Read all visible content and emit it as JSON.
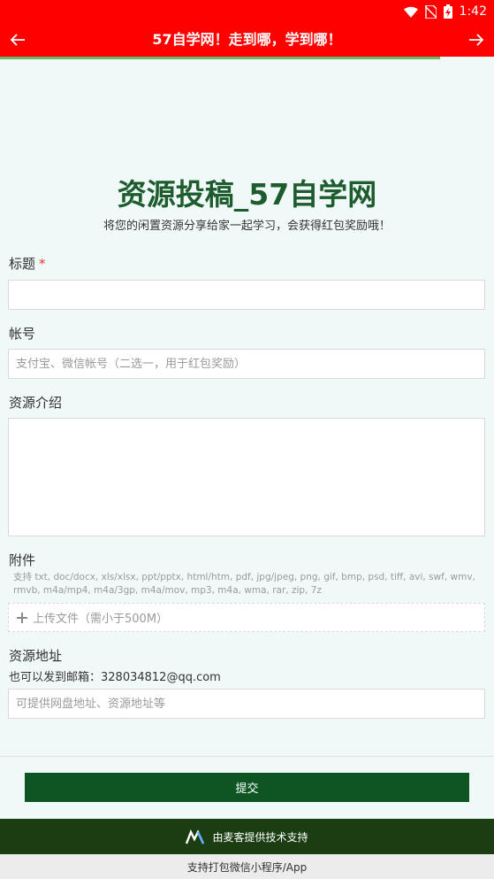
{
  "status_bar": {
    "time": "1:42"
  },
  "app_bar": {
    "title": "57自学网！走到哪，学到哪！"
  },
  "page_load_progress": 0.89,
  "header": {
    "title": "资源投稿_57自学网",
    "subtitle": "将您的闲置资源分享给家一起学习，会获得红包奖励哦！"
  },
  "form": {
    "title_label": "标题",
    "required_mark": "*",
    "title_value": "",
    "account_label": "帐号",
    "account_placeholder": "支付宝、微信帐号（二选一，用于红包奖励）",
    "intro_label": "资源介绍",
    "intro_value": "",
    "attachment_label": "附件",
    "attachment_hint": "支持 txt, doc/docx, xls/xlsx, ppt/pptx, html/htm, pdf, jpg/jpeg, png, gif, bmp, psd, tiff, avi, swf, wmv, rmvb, m4a/mp4, m4a/3gp, m4a/mov, mp3, m4a, wma, rar, zip, 7z",
    "upload_label": "上传文件（需小于500M）",
    "address_label": "资源地址",
    "email_hint": "也可以发到邮箱：328034812@qq.com",
    "address_placeholder": "可提供网盘地址、资源地址等",
    "submit_label": "提交"
  },
  "footer": {
    "powered_by": "由麦客提供技术支持",
    "bottom_text": "支持打包微信小程序/App"
  },
  "colors": {
    "accent_red": "#fe0000",
    "title_green": "#1d5c2e",
    "submit_green": "#0d5523",
    "footer_green": "#1b3d12",
    "progress_green": "#66bb6a"
  }
}
